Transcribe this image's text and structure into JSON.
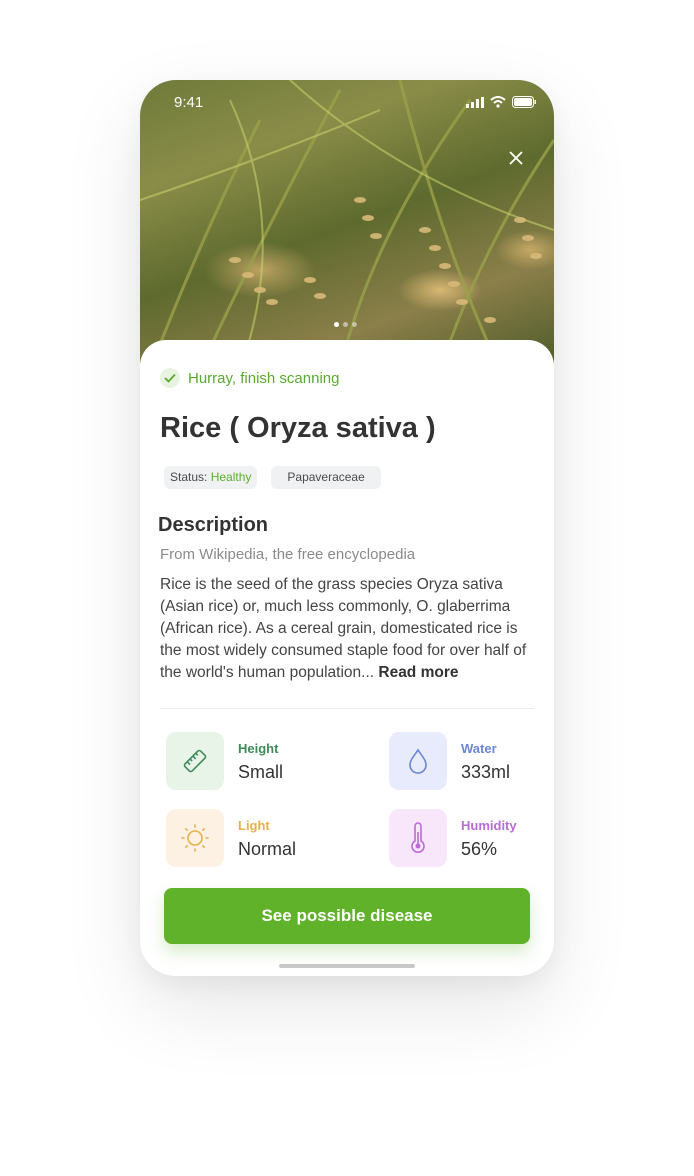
{
  "status_bar": {
    "time": "9:41"
  },
  "hero": {
    "image_alt": "rice-plant-photo",
    "page_dots": 3,
    "active_dot": 0
  },
  "scan": {
    "message": "Hurray, finish scanning"
  },
  "plant": {
    "title": "Rice ( Oryza sativa )",
    "status_label": "Status:",
    "status_value": "Healthy",
    "family": "Papaveraceae"
  },
  "description": {
    "heading": "Description",
    "source": "From Wikipedia, the free encyclopedia",
    "body": "Rice is the seed of the grass species Oryza sativa (Asian rice) or, much less commonly, O. glaberrima (African rice). As a cereal grain, domesticated rice is the most widely consumed staple food for over half of the world's human population... ",
    "read_more": "Read more"
  },
  "stats": [
    {
      "label": "Height",
      "value": "Small",
      "icon": "ruler-icon",
      "label_color": "#3f8a5a",
      "bg": "#e9f4e8"
    },
    {
      "label": "Water",
      "value": "333ml",
      "icon": "water-drop-icon",
      "label_color": "#6b86d6",
      "bg": "#e7ebfb"
    },
    {
      "label": "Light",
      "value": "Normal",
      "icon": "sun-icon",
      "label_color": "#e8b04a",
      "bg": "#fdf1e4"
    },
    {
      "label": "Humidity",
      "value": "56%",
      "icon": "thermometer-icon",
      "label_color": "#bb6ad6",
      "bg": "#f8e6fb"
    }
  ],
  "cta": {
    "label": "See possible disease"
  },
  "colors": {
    "accent": "#61b22b",
    "healthy": "#59b02c"
  }
}
